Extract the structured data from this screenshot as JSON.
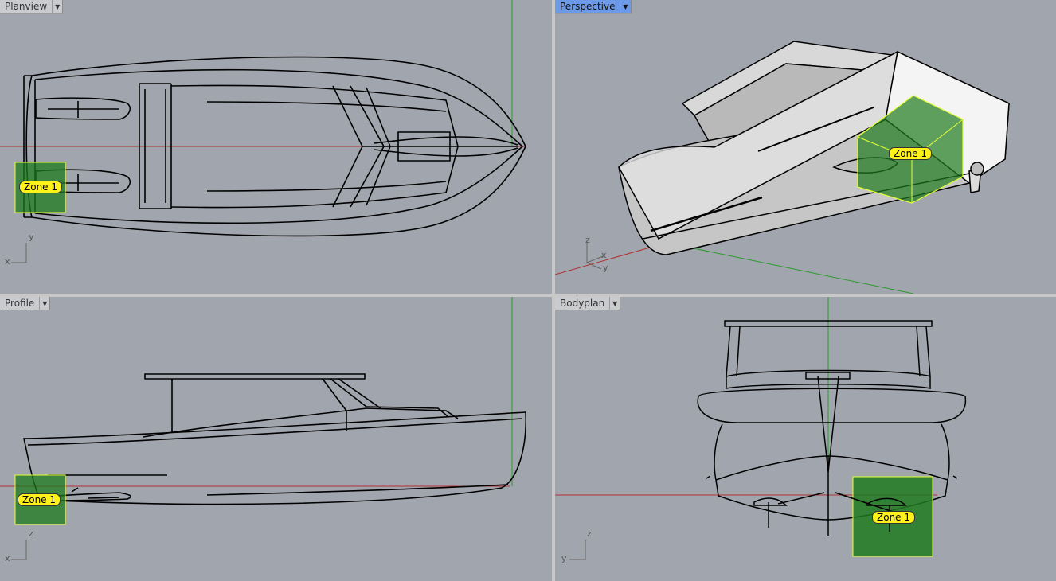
{
  "viewports": {
    "planview": {
      "title": "Planview",
      "zone_label": "Zone 1",
      "axis_h": "x",
      "axis_v": "y"
    },
    "perspective": {
      "title": "Perspective",
      "zone_label": "Zone 1",
      "axis_x": "x",
      "axis_y": "y",
      "axis_z": "z"
    },
    "profile": {
      "title": "Profile",
      "zone_label": "Zone 1",
      "axis_h": "x",
      "axis_v": "z"
    },
    "bodyplan": {
      "title": "Bodyplan",
      "zone_label": "Zone 1",
      "axis_h": "y",
      "axis_v": "z"
    }
  },
  "colors": {
    "background": "#a1a6ae",
    "active_tab": "#6d9ae8",
    "zone_fill": "#1e7a1e",
    "zone_border": "#e6ff33",
    "zone_label_bg": "#fff21a",
    "x_axis": "#b03030",
    "y_axis": "#2a9a2a"
  },
  "icons": [
    "viewport-menu-arrow-icon",
    "axis-gizmo-icon"
  ]
}
